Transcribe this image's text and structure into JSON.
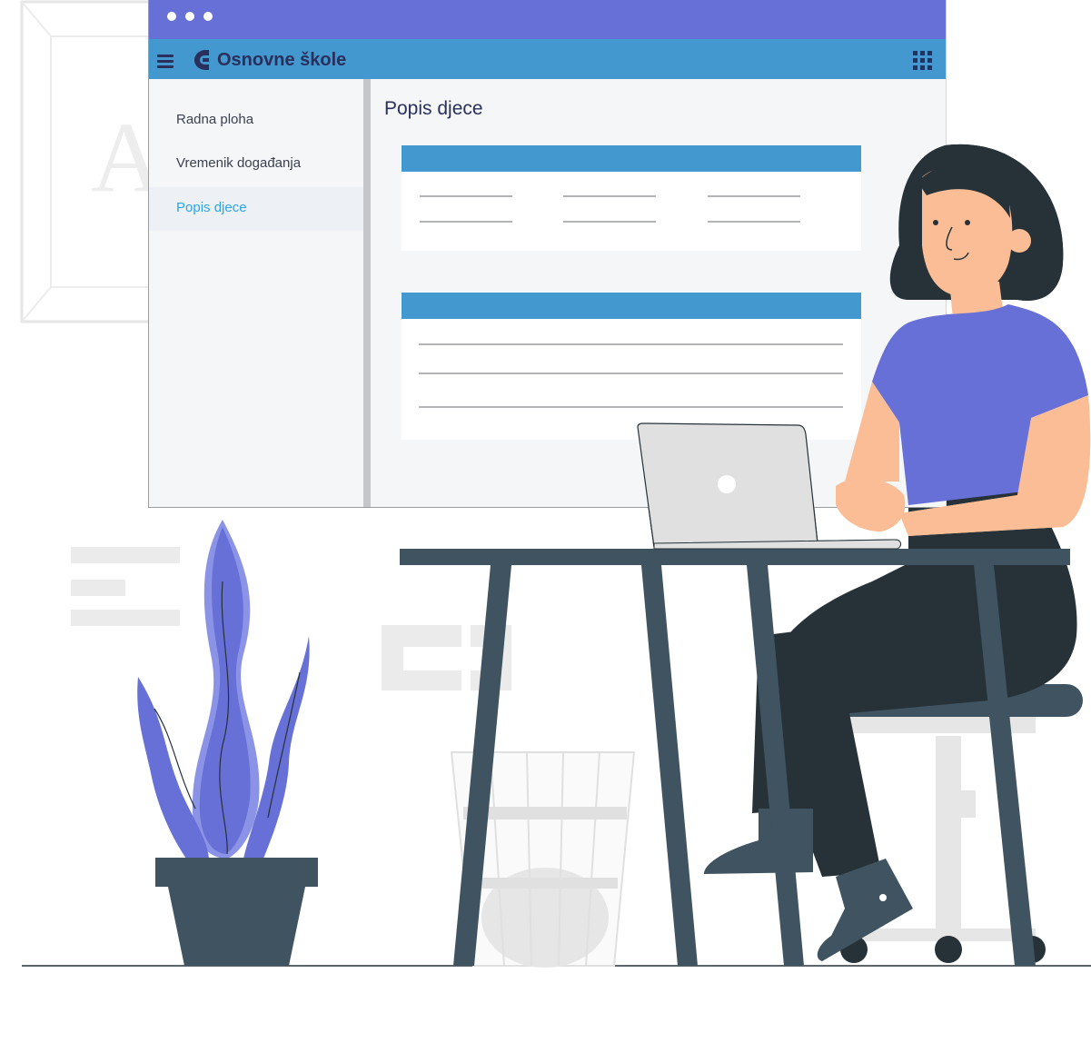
{
  "window": {
    "title_dots": [
      "dot",
      "dot",
      "dot"
    ]
  },
  "appbar": {
    "brand_title": "Osnovne škole",
    "menu_icon": "hamburger-menu-icon",
    "logo_icon": "school-logo-icon",
    "apps_icon": "apps-grid-icon"
  },
  "sidebar": {
    "items": [
      {
        "label": "Radna ploha",
        "active": false
      },
      {
        "label": "Vremenik događanja",
        "active": false
      },
      {
        "label": "Popis djece",
        "active": true
      }
    ]
  },
  "main": {
    "page_title": "Popis djece"
  },
  "colors": {
    "titlebar": "#6670d6",
    "appbar": "#4298cf",
    "brand_text": "#2a2f5c",
    "active_nav": "#2aa5e6",
    "desk": "#3f5361",
    "plant": "#6670d6",
    "shirt": "#6670d6",
    "skin": "#fbbd95",
    "hair": "#263238"
  }
}
